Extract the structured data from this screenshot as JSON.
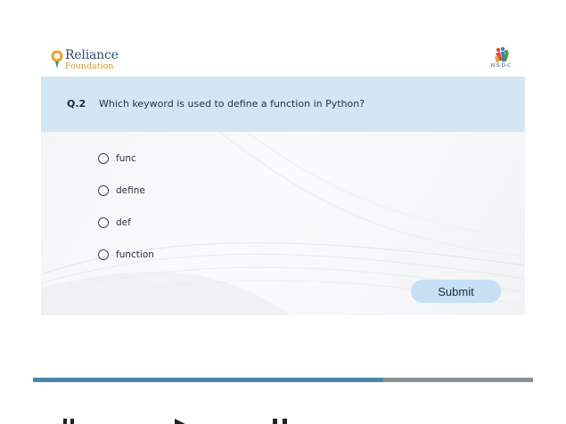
{
  "logos": {
    "left": {
      "line1": "Reliance",
      "line2": "Foundation",
      "mark_icon": "reliance-flame-icon"
    },
    "right": {
      "text": "N·S·D·C",
      "mark_icon": "nsdc-figures-icon"
    }
  },
  "question": {
    "number": "Q.2",
    "text": "Which keyword is used to define a function in Python?"
  },
  "options": [
    {
      "label": "func",
      "selected": false
    },
    {
      "label": "define",
      "selected": false
    },
    {
      "label": "def",
      "selected": false
    },
    {
      "label": "function",
      "selected": false
    }
  ],
  "submit": {
    "label": "Submit"
  },
  "progress": {
    "percent": 70
  },
  "colors": {
    "question_bar": "#d3e6f6",
    "submit_bg": "#c7e0f4",
    "progress_fill": "#4b86a6",
    "progress_track": "#8a8f93"
  },
  "player_controls": [
    "pause-icon",
    "play-icon",
    "pause-icon"
  ]
}
